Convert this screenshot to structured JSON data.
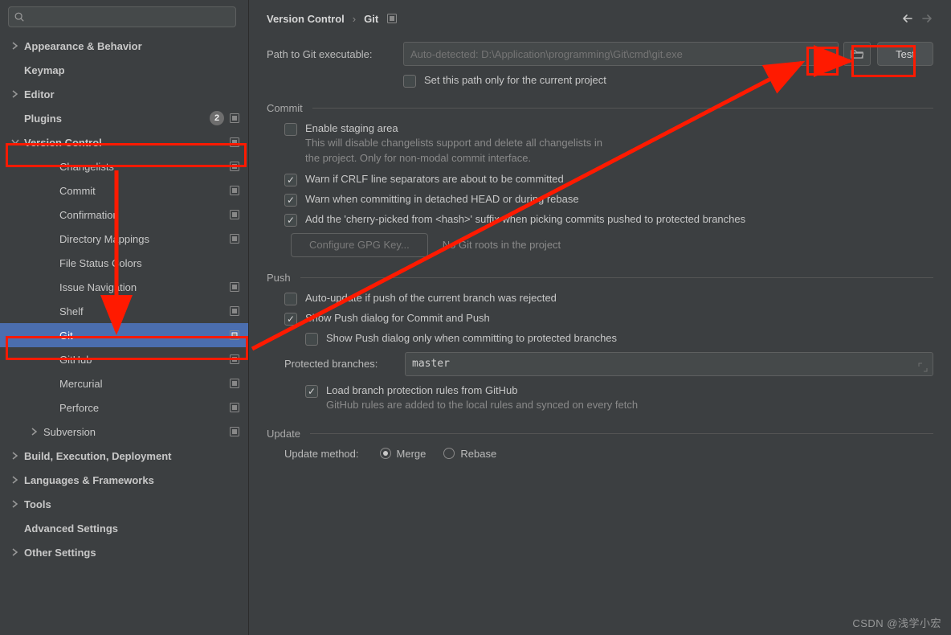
{
  "search": {
    "placeholder": ""
  },
  "sidebar": {
    "items": [
      {
        "label": "Appearance & Behavior",
        "chevron": "right",
        "bold": true,
        "depth": 1,
        "end": []
      },
      {
        "label": "Keymap",
        "chevron": "none",
        "bold": true,
        "depth": 1,
        "end": []
      },
      {
        "label": "Editor",
        "chevron": "right",
        "bold": true,
        "depth": 1,
        "end": []
      },
      {
        "label": "Plugins",
        "chevron": "none",
        "bold": true,
        "depth": 1,
        "end": [
          "count",
          "proj"
        ],
        "count": "2"
      },
      {
        "label": "Version Control",
        "chevron": "down",
        "bold": true,
        "depth": 1,
        "end": [
          "proj"
        ]
      },
      {
        "label": "Changelists",
        "chevron": "none",
        "bold": false,
        "depth": 3,
        "end": [
          "proj"
        ]
      },
      {
        "label": "Commit",
        "chevron": "none",
        "bold": false,
        "depth": 3,
        "end": [
          "proj"
        ]
      },
      {
        "label": "Confirmation",
        "chevron": "none",
        "bold": false,
        "depth": 3,
        "end": [
          "proj"
        ]
      },
      {
        "label": "Directory Mappings",
        "chevron": "none",
        "bold": false,
        "depth": 3,
        "end": [
          "proj"
        ]
      },
      {
        "label": "File Status Colors",
        "chevron": "none",
        "bold": false,
        "depth": 3,
        "end": []
      },
      {
        "label": "Issue Navigation",
        "chevron": "none",
        "bold": false,
        "depth": 3,
        "end": [
          "proj"
        ]
      },
      {
        "label": "Shelf",
        "chevron": "none",
        "bold": false,
        "depth": 3,
        "end": [
          "proj"
        ]
      },
      {
        "label": "Git",
        "chevron": "none",
        "bold": false,
        "depth": 3,
        "end": [
          "proj"
        ],
        "selected": true
      },
      {
        "label": "GitHub",
        "chevron": "none",
        "bold": false,
        "depth": 3,
        "end": [
          "proj"
        ]
      },
      {
        "label": "Mercurial",
        "chevron": "none",
        "bold": false,
        "depth": 3,
        "end": [
          "proj"
        ]
      },
      {
        "label": "Perforce",
        "chevron": "none",
        "bold": false,
        "depth": 3,
        "end": [
          "proj"
        ]
      },
      {
        "label": "Subversion",
        "chevron": "right",
        "bold": false,
        "depth": 2,
        "end": [
          "proj"
        ]
      },
      {
        "label": "Build, Execution, Deployment",
        "chevron": "right",
        "bold": true,
        "depth": 1,
        "end": []
      },
      {
        "label": "Languages & Frameworks",
        "chevron": "right",
        "bold": true,
        "depth": 1,
        "end": []
      },
      {
        "label": "Tools",
        "chevron": "right",
        "bold": true,
        "depth": 1,
        "end": []
      },
      {
        "label": "Advanced Settings",
        "chevron": "none",
        "bold": true,
        "depth": 1,
        "end": []
      },
      {
        "label": "Other Settings",
        "chevron": "right",
        "bold": true,
        "depth": 1,
        "end": []
      }
    ]
  },
  "breadcrumb": {
    "a": "Version Control",
    "b": "Git"
  },
  "path": {
    "label": "Path to Git executable:",
    "placeholder": "Auto-detected: D:\\Application\\programming\\Git\\cmd\\git.exe",
    "test": "Test",
    "set_only": "Set this path only for the current project"
  },
  "commit": {
    "title": "Commit",
    "staging": "Enable staging area",
    "staging_hint": "This will disable changelists support and delete all changelists in\nthe project. Only for non-modal commit interface.",
    "crlf": "Warn if CRLF line separators are about to be committed",
    "detached": "Warn when committing in detached HEAD or during rebase",
    "cherry": "Add the 'cherry-picked from <hash>' suffix when picking commits pushed to protected branches",
    "gpg": "Configure GPG Key...",
    "no_roots": "No Git roots in the project"
  },
  "push": {
    "title": "Push",
    "auto_update": "Auto-update if push of the current branch was rejected",
    "show_dialog": "Show Push dialog for Commit and Push",
    "show_dialog_protected": "Show Push dialog only when committing to protected branches",
    "protected_label": "Protected branches:",
    "protected_value": "master",
    "load_rules": "Load branch protection rules from GitHub",
    "load_rules_hint": "GitHub rules are added to the local rules and synced on every fetch"
  },
  "update": {
    "title": "Update",
    "method_label": "Update method:",
    "merge": "Merge",
    "rebase": "Rebase"
  },
  "watermark": "CSDN @浅学小宏"
}
